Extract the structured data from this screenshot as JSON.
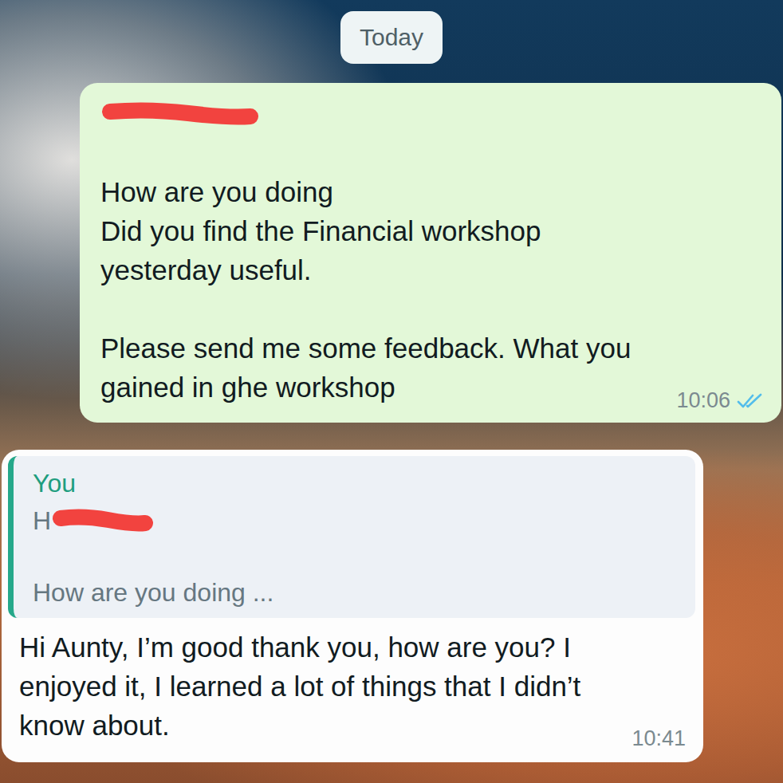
{
  "date_divider": "Today",
  "outgoing": {
    "redacted_first_line": true,
    "lines": [
      "",
      "How are you doing",
      "Did you find the Financial workshop",
      "yesterday useful.",
      "",
      "Please send me some feedback. What you",
      "gained in ghe workshop"
    ],
    "time": "10:06",
    "read": true
  },
  "incoming": {
    "quote": {
      "sender": "You",
      "visible_text": "H",
      "redacted": true,
      "preview": "How are you doing ..."
    },
    "lines": [
      "Hi Aunty, I’m good thank you, how are you? I",
      "enjoyed it, I learned a lot of things that I didn’t",
      "know about."
    ],
    "time": "10:41"
  }
}
